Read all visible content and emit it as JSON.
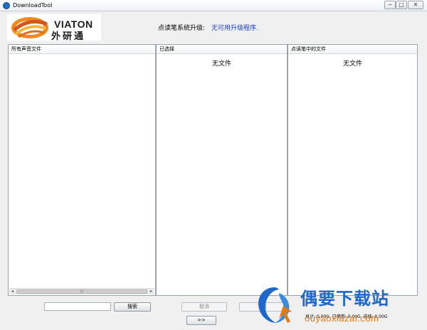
{
  "window": {
    "title": "DownloadTool",
    "min_glyph": "─",
    "max_glyph": "□",
    "close_glyph": "✕"
  },
  "header": {
    "logo_en": "VIATON",
    "logo_cn": "外研通",
    "upgrade_label": "点读笔系统升级:",
    "upgrade_status": "无可用升级程序."
  },
  "panels": {
    "all_files": {
      "header": "所有声音文件"
    },
    "selected": {
      "header": "已选择",
      "empty_text": "无文件"
    },
    "pen_files": {
      "header": "点读笔中的文件",
      "empty_text": "无文件"
    }
  },
  "scrollbar": {
    "left_arrow": "◂",
    "right_arrow": "▸",
    "grip": "|||"
  },
  "search": {
    "value": "",
    "placeholder": "",
    "button_label": "搜索"
  },
  "actions": {
    "cancel_label": "取消",
    "download_label": "下载",
    "next_label": ">>"
  },
  "storage": {
    "text": "总计: 0.00G, 已使用: 0.00G, 选择: 0.00G"
  },
  "watermark": {
    "text": "偶要下载站",
    "url": "ouyaoxiazai.com"
  },
  "colors": {
    "status_blue": "#1a3ec8",
    "logo_orange": "#f08a1c",
    "watermark_blue": "#1f67c9",
    "watermark_orange": "#e07b18"
  }
}
